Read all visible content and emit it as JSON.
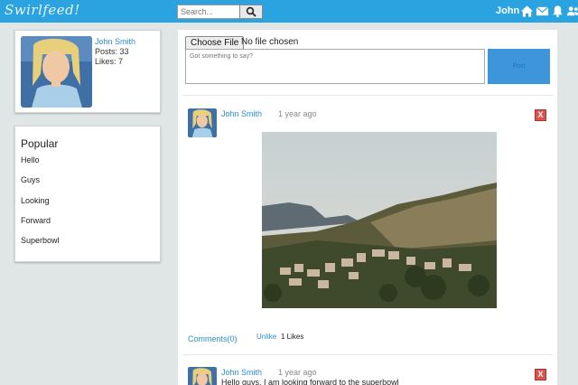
{
  "app": {
    "logo": "Swirlfeed!"
  },
  "header": {
    "search_placeholder": "Search...",
    "user_name": "John",
    "icons": [
      "home-icon",
      "mail-icon",
      "bell-icon",
      "users-icon"
    ]
  },
  "profile": {
    "name": "John Smith",
    "posts": "Posts: 33",
    "likes": "Likes: 7"
  },
  "popular": {
    "title": "Popular",
    "items": [
      "Hello",
      "Guys",
      "Looking",
      "Forward",
      "Superbowl"
    ]
  },
  "composer": {
    "choose_file": "Choose File",
    "no_file": "No file chosen",
    "placeholder": "Got something to say?",
    "post_button": "Post"
  },
  "posts": [
    {
      "author": "John Smith",
      "time": "1 year ago",
      "delete": "X",
      "comments": "Comments(0)",
      "unlike": "Unlike",
      "likes": "1 Likes"
    },
    {
      "author": "John Smith",
      "time": "1 year ago",
      "delete": "X",
      "text": "Hello guys, I am looking forward to the superbowl"
    }
  ],
  "colors": {
    "accent": "#2aa3e0",
    "link": "#2a8fcf",
    "delete": "#d9534f"
  }
}
